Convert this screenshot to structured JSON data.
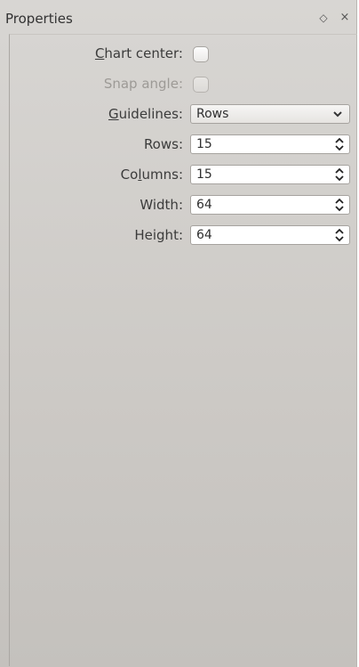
{
  "dock": {
    "title": "Properties",
    "float_icon": "diamond-icon",
    "close_icon": "close-icon",
    "float_glyph": "◇",
    "close_glyph": "×"
  },
  "fields": {
    "chart_center": {
      "label_mnemonic": "C",
      "label_rest": "hart center:",
      "checked": false
    },
    "snap_angle": {
      "label": "Snap angle:",
      "checked": false,
      "enabled": false
    },
    "guidelines": {
      "label_mnemonic": "G",
      "label_rest": "uidelines:",
      "value": "Rows"
    },
    "rows": {
      "label": "Rows:",
      "value": "15"
    },
    "columns": {
      "label_pre": "Co",
      "label_mnemonic": "l",
      "label_rest": "umns:",
      "value": "15"
    },
    "width": {
      "label": "Width:",
      "value": "64"
    },
    "height": {
      "label": "Height:",
      "value": "64"
    }
  }
}
